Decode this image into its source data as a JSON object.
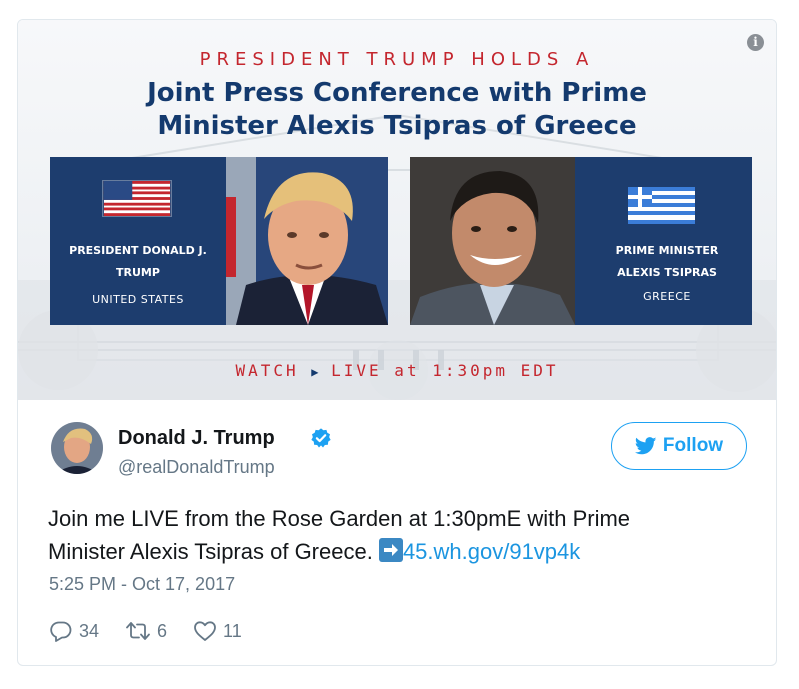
{
  "banner": {
    "kicker": "PRESIDENT TRUMP HOLDS A",
    "title_line1": "Joint Press Conference with Prime",
    "title_line2": "Minister Alexis Tsipras of Greece",
    "left": {
      "name_line1": "PRESIDENT DONALD J.",
      "name_line2": "TRUMP",
      "country": "UNITED STATES"
    },
    "right": {
      "name_line1": "PRIME MINISTER",
      "name_line2": "ALEXIS TSIPRAS",
      "country": "GREECE"
    },
    "watch_prefix": "WATCH",
    "watch_suffix": "LIVE at 1:30pm EDT",
    "info_glyph": "i"
  },
  "tweet": {
    "author_name": "Donald J. Trump",
    "author_handle": "@realDonaldTrump",
    "follow_label": "Follow",
    "text_line1": "Join me LIVE from the Rose Garden at 1:30pmE with Prime",
    "text_line2_prefix": "Minister Alexis Tsipras of Greece. ",
    "link": "45.wh.gov/91vp4k",
    "timestamp": "5:25 PM - Oct 17, 2017",
    "replies": "34",
    "retweets": "6",
    "likes": "11"
  },
  "colors": {
    "accent": "#1da1f2",
    "banner_red": "#c4262e",
    "banner_navy": "#143a6e",
    "panel_blue": "#1d3d6e",
    "muted": "#657786"
  },
  "icons": [
    "info-icon",
    "verified-badge-icon",
    "twitter-bird-icon",
    "reply-icon",
    "retweet-icon",
    "like-icon",
    "arrow-right-emoji-icon"
  ]
}
